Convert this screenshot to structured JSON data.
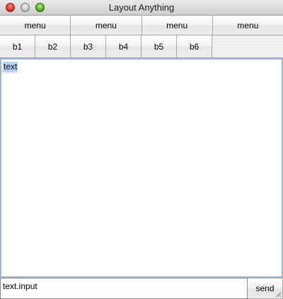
{
  "window": {
    "title": "Layout Anything"
  },
  "menu_row": {
    "items": [
      {
        "label": "menu"
      },
      {
        "label": "menu"
      },
      {
        "label": "menu"
      },
      {
        "label": "menu"
      }
    ]
  },
  "button_row": {
    "buttons": [
      {
        "label": "b1"
      },
      {
        "label": "b2"
      },
      {
        "label": "b3"
      },
      {
        "label": "b4"
      },
      {
        "label": "b5"
      },
      {
        "label": "b6"
      }
    ]
  },
  "text_area": {
    "selected_text": "text"
  },
  "input_row": {
    "input_value": "text.input",
    "send_label": "send"
  },
  "colors": {
    "selection": "#b7d3ff",
    "focus_border": "#9fb5d2"
  }
}
